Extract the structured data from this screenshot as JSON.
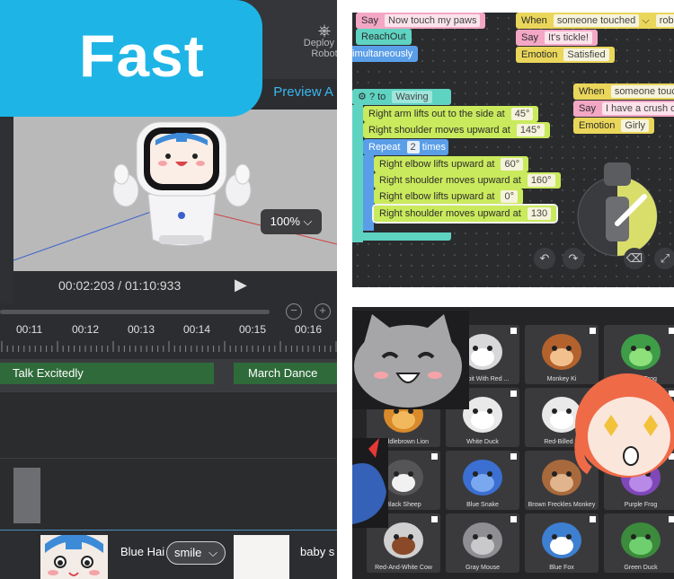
{
  "badge": {
    "text": "Fast"
  },
  "editor": {
    "deploy_label": "Deploy to Robot",
    "preview_label": "Preview A",
    "zoom": "100%",
    "time": "00:02:203 / 01:10:933",
    "ticks": [
      "00:11",
      "00:12",
      "00:13",
      "00:14",
      "00:15",
      "00:16"
    ],
    "clips": [
      "Talk Excitedly",
      "March Dance"
    ],
    "face_name": "Blue Hai",
    "expression": "smile",
    "baby_name": "baby s"
  },
  "blocks": {
    "say1": {
      "label": "Say",
      "value": "Now touch my paws"
    },
    "reachout": "ReachOut",
    "simultaneously": "imultaneously",
    "when1": {
      "label": "When",
      "value": "someone touched",
      "value2": "robo"
    },
    "say2": {
      "label": "Say",
      "value": "It's tickle!"
    },
    "emotion1": {
      "label": "Emotion",
      "value": "Satisfied"
    },
    "func": {
      "to": "to",
      "name": "Waving"
    },
    "arm": {
      "label": "Right arm lifts out to the side at",
      "value": "45°"
    },
    "shoulder1": {
      "label": "Right shoulder moves upward at",
      "value": "145°"
    },
    "repeat": {
      "label": "Repeat",
      "count": "2",
      "suffix": "times"
    },
    "elbow1": {
      "label": "Right elbow lifts upward at",
      "value": "60°"
    },
    "shoulder2": {
      "label": "Right shoulder moves upward at",
      "value": "160°"
    },
    "elbow2": {
      "label": "Right elbow lifts upward at",
      "value": "0°"
    },
    "shoulder3": {
      "label": "Right shoulder moves upward at",
      "value": "130"
    },
    "when2": {
      "label": "When",
      "value": "someone touc"
    },
    "say3": {
      "label": "Say",
      "value": "I have a crush or"
    },
    "emotion2": {
      "label": "Emotion",
      "value": "Girly"
    }
  },
  "faces": {
    "cells": [
      {
        "label": ""
      },
      {
        "label": "Rabbit With Red ..."
      },
      {
        "label": "Monkey Ki"
      },
      {
        "label": "Green Frog"
      },
      {
        "label": "Saddlebrown Lion"
      },
      {
        "label": "White Duck"
      },
      {
        "label": "Red-Billed D"
      },
      {
        "label": ""
      },
      {
        "label": "Black Sheep"
      },
      {
        "label": "Blue Snake"
      },
      {
        "label": "Brown Freckles Monkey"
      },
      {
        "label": "Purple Frog"
      },
      {
        "label": "Red-And-White Cow"
      },
      {
        "label": "Gray Mouse"
      },
      {
        "label": "Blue Fox"
      },
      {
        "label": "Green Duck"
      }
    ]
  },
  "colors": {
    "accent": "#1eb5e6",
    "clip_green": "#2f6b3a",
    "preview_blue": "#3ab7f0"
  }
}
